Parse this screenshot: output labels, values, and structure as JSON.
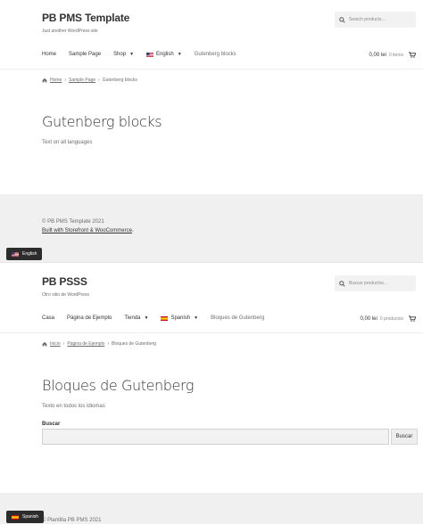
{
  "site_en": {
    "title": "PB PMS Template",
    "tagline": "Just another WordPress site",
    "search_placeholder": "Search products…",
    "nav": [
      {
        "label": "Home"
      },
      {
        "label": "Sample Page"
      },
      {
        "label": "Shop",
        "dropdown": true
      },
      {
        "label": "English",
        "dropdown": true,
        "flag": "us-flag"
      },
      {
        "label": "Gutenberg blocks"
      }
    ],
    "cart_amount": "0,00 lei",
    "cart_count": "0 items",
    "breadcrumb": [
      "Home",
      "Sample Page",
      "Gutenberg blocks"
    ],
    "page_title": "Gutenberg blocks",
    "page_text": "Text on all languages",
    "footer_copy": "© PB PMS Template 2021",
    "footer_link": "Built with Storefront & WooCommerce",
    "footer_link_end": ".",
    "lang_switch": "English"
  },
  "site_es": {
    "title": "PB PSSS",
    "tagline": "Otro sitio de WordPress",
    "search_placeholder": "Buscar productos…",
    "nav": [
      {
        "label": "Casa"
      },
      {
        "label": "Página de Ejemplo"
      },
      {
        "label": "Tienda",
        "dropdown": true
      },
      {
        "label": "Spanish",
        "dropdown": true,
        "flag": "es-flag"
      },
      {
        "label": "Bloques de Gutenberg"
      }
    ],
    "cart_amount": "0,00 lei",
    "cart_count": "0 productos",
    "breadcrumb": [
      "Inicio",
      "Página de Ejemplo",
      "Bloques de Gutenberg"
    ],
    "page_title": "Bloques de Gutenberg",
    "page_text": "Texto en todos los idiomas",
    "search_label": "Buscar",
    "search_button": "Buscar",
    "footer_copy": "© Plantilla PB PMS 2021",
    "lang_switch": "Spanish"
  },
  "colors": {
    "footer_bg": "#f0f0f0",
    "lang_pill_bg": "#2c2c2c",
    "text": "#333333",
    "muted": "#6d6d6d"
  }
}
